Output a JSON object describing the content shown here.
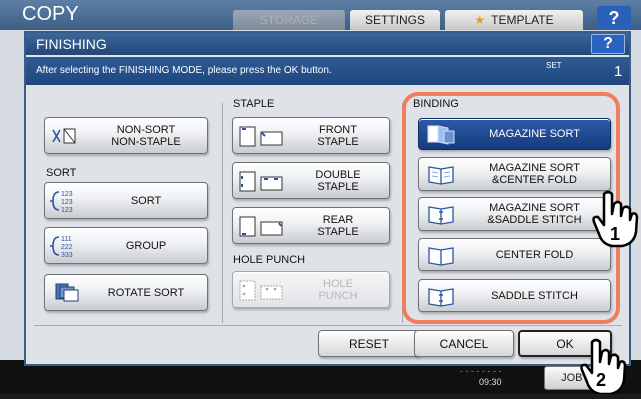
{
  "background": {
    "app_title": "COPY",
    "tabs": [
      "STORAGE",
      "SETTINGS",
      "TEMPLATE"
    ],
    "help_label": "?",
    "time": "09:30",
    "job_status_label": "JOB S"
  },
  "dialog": {
    "title": "FINISHING",
    "help_label": "?",
    "message": "After selecting the FINISHING MODE, please press the OK button.",
    "set_label": "SET",
    "set_count": "1"
  },
  "sections": {
    "sort": "SORT",
    "staple": "STAPLE",
    "hole_punch": "HOLE PUNCH",
    "binding": "BINDING"
  },
  "buttons": {
    "non_sort": {
      "line1": "NON-SORT",
      "line2": "NON-STAPLE"
    },
    "sort": {
      "label": "SORT"
    },
    "group": {
      "label": "GROUP"
    },
    "rotate_sort": {
      "label": "ROTATE SORT"
    },
    "front_staple": {
      "line1": "FRONT",
      "line2": "STAPLE"
    },
    "double_staple": {
      "line1": "DOUBLE",
      "line2": "STAPLE"
    },
    "rear_staple": {
      "line1": "REAR",
      "line2": "STAPLE"
    },
    "hole_punch": {
      "line1": "HOLE",
      "line2": "PUNCH"
    },
    "magazine_sort": {
      "label": "MAGAZINE SORT"
    },
    "magazine_center_fold": {
      "line1": "MAGAZINE SORT",
      "line2": "&CENTER FOLD"
    },
    "magazine_saddle_stitch": {
      "line1": "MAGAZINE SORT",
      "line2": "&SADDLE STITCH"
    },
    "center_fold": {
      "label": "CENTER FOLD"
    },
    "saddle_stitch": {
      "label": "SADDLE STITCH"
    }
  },
  "footer": {
    "reset": "RESET",
    "cancel": "CANCEL",
    "ok": "OK"
  },
  "annotations": {
    "step1": "1",
    "step2": "2",
    "highlight_color": "#f07d5e"
  },
  "icon_numbers": {
    "sort": [
      "123",
      "123",
      "123"
    ],
    "group": [
      "111",
      "222",
      "333"
    ]
  }
}
